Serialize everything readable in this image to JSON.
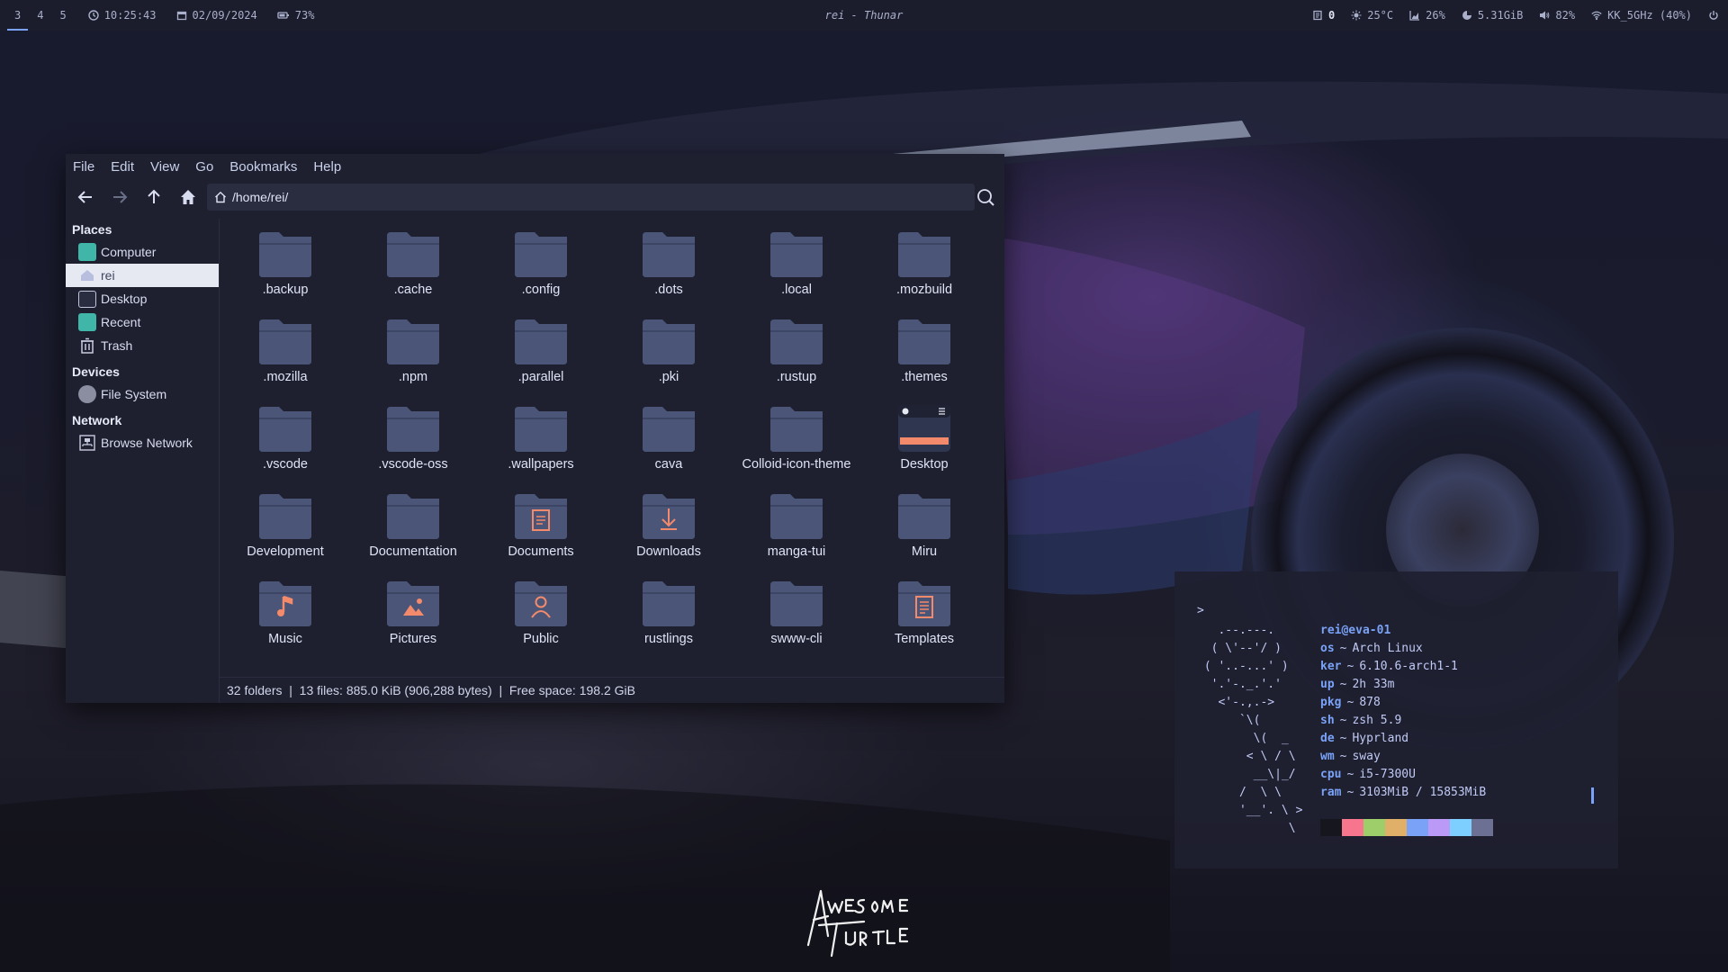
{
  "topbar": {
    "workspaces": [
      "3",
      "4",
      "5"
    ],
    "active_workspace": "3",
    "time": "10:25:43",
    "date": "02/09/2024",
    "battery": "73%",
    "window_title": "rei - Thunar",
    "notifications": "0",
    "temperature": "25°C",
    "cpu": "26%",
    "memory": "5.31GiB",
    "volume": "82%",
    "wifi": "KK_5GHz (40%)"
  },
  "thunar": {
    "menu": [
      "File",
      "Edit",
      "View",
      "Go",
      "Bookmarks",
      "Help"
    ],
    "path": "/home/rei/",
    "sidebar": {
      "places_heading": "Places",
      "places": [
        {
          "label": "Computer",
          "icon": "computer-icon",
          "color": "#3fb6a8"
        },
        {
          "label": "rei",
          "icon": "home-icon",
          "color": "#9aa0c8"
        },
        {
          "label": "Desktop",
          "icon": "desktop-icon",
          "color": "#4a5070"
        },
        {
          "label": "Recent",
          "icon": "recent-icon",
          "color": "#3fb6a8"
        },
        {
          "label": "Trash",
          "icon": "trash-icon",
          "color": "#9aa0b8"
        }
      ],
      "devices_heading": "Devices",
      "devices": [
        {
          "label": "File System",
          "icon": "drive-icon",
          "color": "#8a8ea0"
        }
      ],
      "network_heading": "Network",
      "network": [
        {
          "label": "Browse Network",
          "icon": "network-icon",
          "color": "#9aa0b8"
        }
      ]
    },
    "files": [
      {
        "name": ".backup",
        "icon": "folder-icon"
      },
      {
        "name": ".cache",
        "icon": "folder-icon"
      },
      {
        "name": ".config",
        "icon": "folder-icon"
      },
      {
        "name": ".dots",
        "icon": "folder-icon"
      },
      {
        "name": ".local",
        "icon": "folder-icon"
      },
      {
        "name": ".mozbuild",
        "icon": "folder-icon"
      },
      {
        "name": ".mozilla",
        "icon": "folder-icon"
      },
      {
        "name": ".npm",
        "icon": "folder-icon"
      },
      {
        "name": ".parallel",
        "icon": "folder-icon"
      },
      {
        "name": ".pki",
        "icon": "folder-icon"
      },
      {
        "name": ".rustup",
        "icon": "folder-icon"
      },
      {
        "name": ".themes",
        "icon": "folder-icon"
      },
      {
        "name": ".vscode",
        "icon": "folder-icon"
      },
      {
        "name": ".vscode-oss",
        "icon": "folder-icon"
      },
      {
        "name": ".wallpapers",
        "icon": "folder-icon"
      },
      {
        "name": "cava",
        "icon": "folder-icon"
      },
      {
        "name": "Colloid-icon-theme",
        "icon": "folder-icon"
      },
      {
        "name": "Desktop",
        "icon": "desktop-folder-icon"
      },
      {
        "name": "Development",
        "icon": "folder-icon"
      },
      {
        "name": "Documentation",
        "icon": "folder-icon"
      },
      {
        "name": "Documents",
        "icon": "documents-folder-icon"
      },
      {
        "name": "Downloads",
        "icon": "downloads-folder-icon"
      },
      {
        "name": "manga-tui",
        "icon": "folder-icon"
      },
      {
        "name": "Miru",
        "icon": "folder-icon"
      },
      {
        "name": "Music",
        "icon": "music-folder-icon"
      },
      {
        "name": "Pictures",
        "icon": "pictures-folder-icon"
      },
      {
        "name": "Public",
        "icon": "public-folder-icon"
      },
      {
        "name": "rustlings",
        "icon": "folder-icon"
      },
      {
        "name": "swww-cli",
        "icon": "folder-icon"
      },
      {
        "name": "Templates",
        "icon": "templates-folder-icon"
      }
    ],
    "status": "32 folders  |  13 files: 885.0 KiB (906,288 bytes)  |  Free space: 198.2 GiB"
  },
  "fetch": {
    "prompt": ">",
    "ascii": "   .--.---.\n  ( \\'--'/ )\n ( '..-...' )\n  '.'-._.'.'\n   <'-.,.->\n      `\\(\n        \\(  _\n       < \\ / \\\n        __\\|_/\n      /  \\ \\\n      '__'. \\ >\n             \\",
    "user": "rei@eva-01",
    "rows": [
      {
        "key": "os",
        "value": "Arch Linux"
      },
      {
        "key": "ker",
        "value": "6.10.6-arch1-1"
      },
      {
        "key": "up",
        "value": "2h 33m"
      },
      {
        "key": "pkg",
        "value": "878"
      },
      {
        "key": "sh",
        "value": "zsh 5.9"
      },
      {
        "key": "de",
        "value": "Hyprland"
      },
      {
        "key": "wm",
        "value": "sway"
      },
      {
        "key": "cpu",
        "value": "i5-7300U"
      },
      {
        "key": "ram",
        "value": "3103MiB / 15853MiB"
      }
    ],
    "separator": "~",
    "palette": [
      "#15161e",
      "#f7768e",
      "#9ece6a",
      "#e0af68",
      "#7aa2f7",
      "#bb9af7",
      "#7dcfff",
      "#6c7194"
    ]
  },
  "colors": {
    "folder": "#4a5578",
    "folder_dark": "#3c4564",
    "accent": "#f38a6b",
    "link": "#7aa2f7"
  }
}
